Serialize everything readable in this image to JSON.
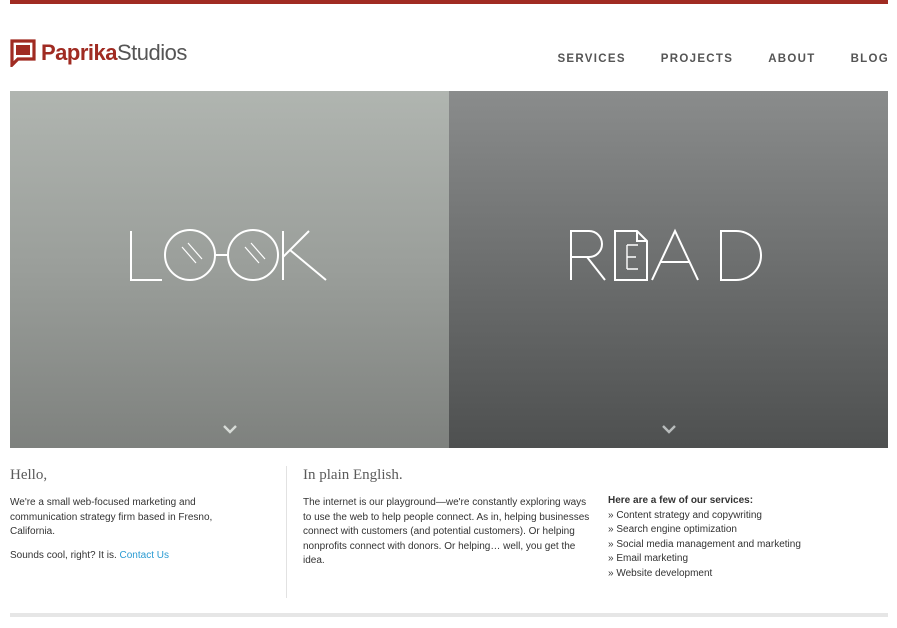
{
  "logo": {
    "bold": "Paprika",
    "light": "Studios"
  },
  "nav": [
    {
      "label": "SERVICES"
    },
    {
      "label": "PROJECTS"
    },
    {
      "label": "ABOUT"
    },
    {
      "label": "BLOG"
    }
  ],
  "hero": {
    "look": {
      "word": "LOOK"
    },
    "read": {
      "word": "READ"
    }
  },
  "intro": {
    "heading": "Hello,",
    "body": "We're a small web-focused marketing and communication strategy firm based in Fresno, California.",
    "cta_prefix": "Sounds cool, right? It is. ",
    "cta_link": "Contact Us"
  },
  "plain": {
    "heading": "In plain English.",
    "body": "The internet is our playground—we're constantly exploring ways to use the web to help people connect. As in, helping businesses connect with customers (and potential customers). Or helping nonprofits connect with donors. Or helping… well, you get the idea."
  },
  "services": {
    "heading": "Here are a few of our services:",
    "items": [
      "» Content strategy and copywriting",
      "» Search engine optimization",
      "» Social media management and marketing",
      "» Email marketing",
      "» Website development"
    ]
  },
  "colors": {
    "brand": "#a02b22",
    "link": "#2a9bd2"
  }
}
